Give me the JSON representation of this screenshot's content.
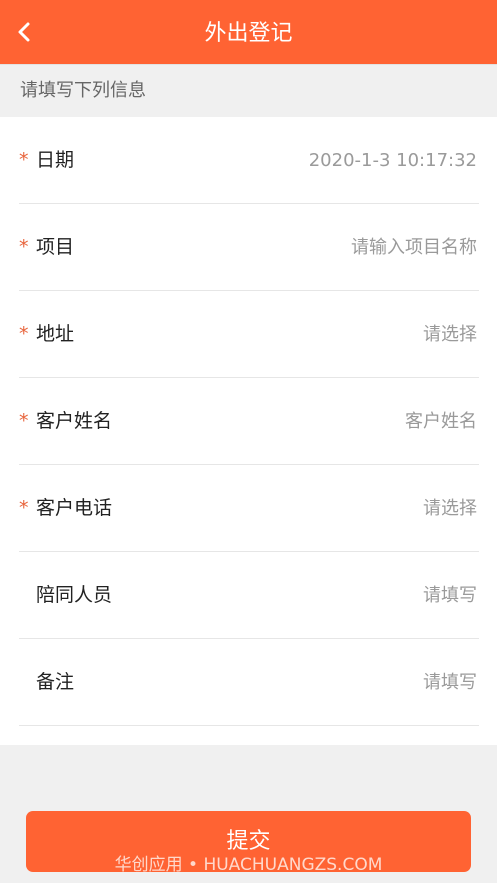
{
  "header": {
    "title": "外出登记",
    "back_icon": "chevron-left-icon"
  },
  "form_hint": "请填写下列信息",
  "fields": [
    {
      "required": "*",
      "label": "日期",
      "value": "2020-1-3 10:17:32"
    },
    {
      "required": "*",
      "label": "项目",
      "value": "请输入项目名称"
    },
    {
      "required": "*",
      "label": "地址",
      "value": "请选择"
    },
    {
      "required": "*",
      "label": "客户姓名",
      "value": "客户姓名"
    },
    {
      "required": "*",
      "label": "客户电话",
      "value": "请选择"
    },
    {
      "required": "",
      "label": "陪同人员",
      "value": "请填写"
    },
    {
      "required": "",
      "label": "备注",
      "value": "请填写"
    }
  ],
  "submit_label": "提交",
  "watermark": "华创应用 • HUACHUANGZS.COM",
  "colors": {
    "accent": "#ff6333",
    "required": "#e8643c"
  }
}
